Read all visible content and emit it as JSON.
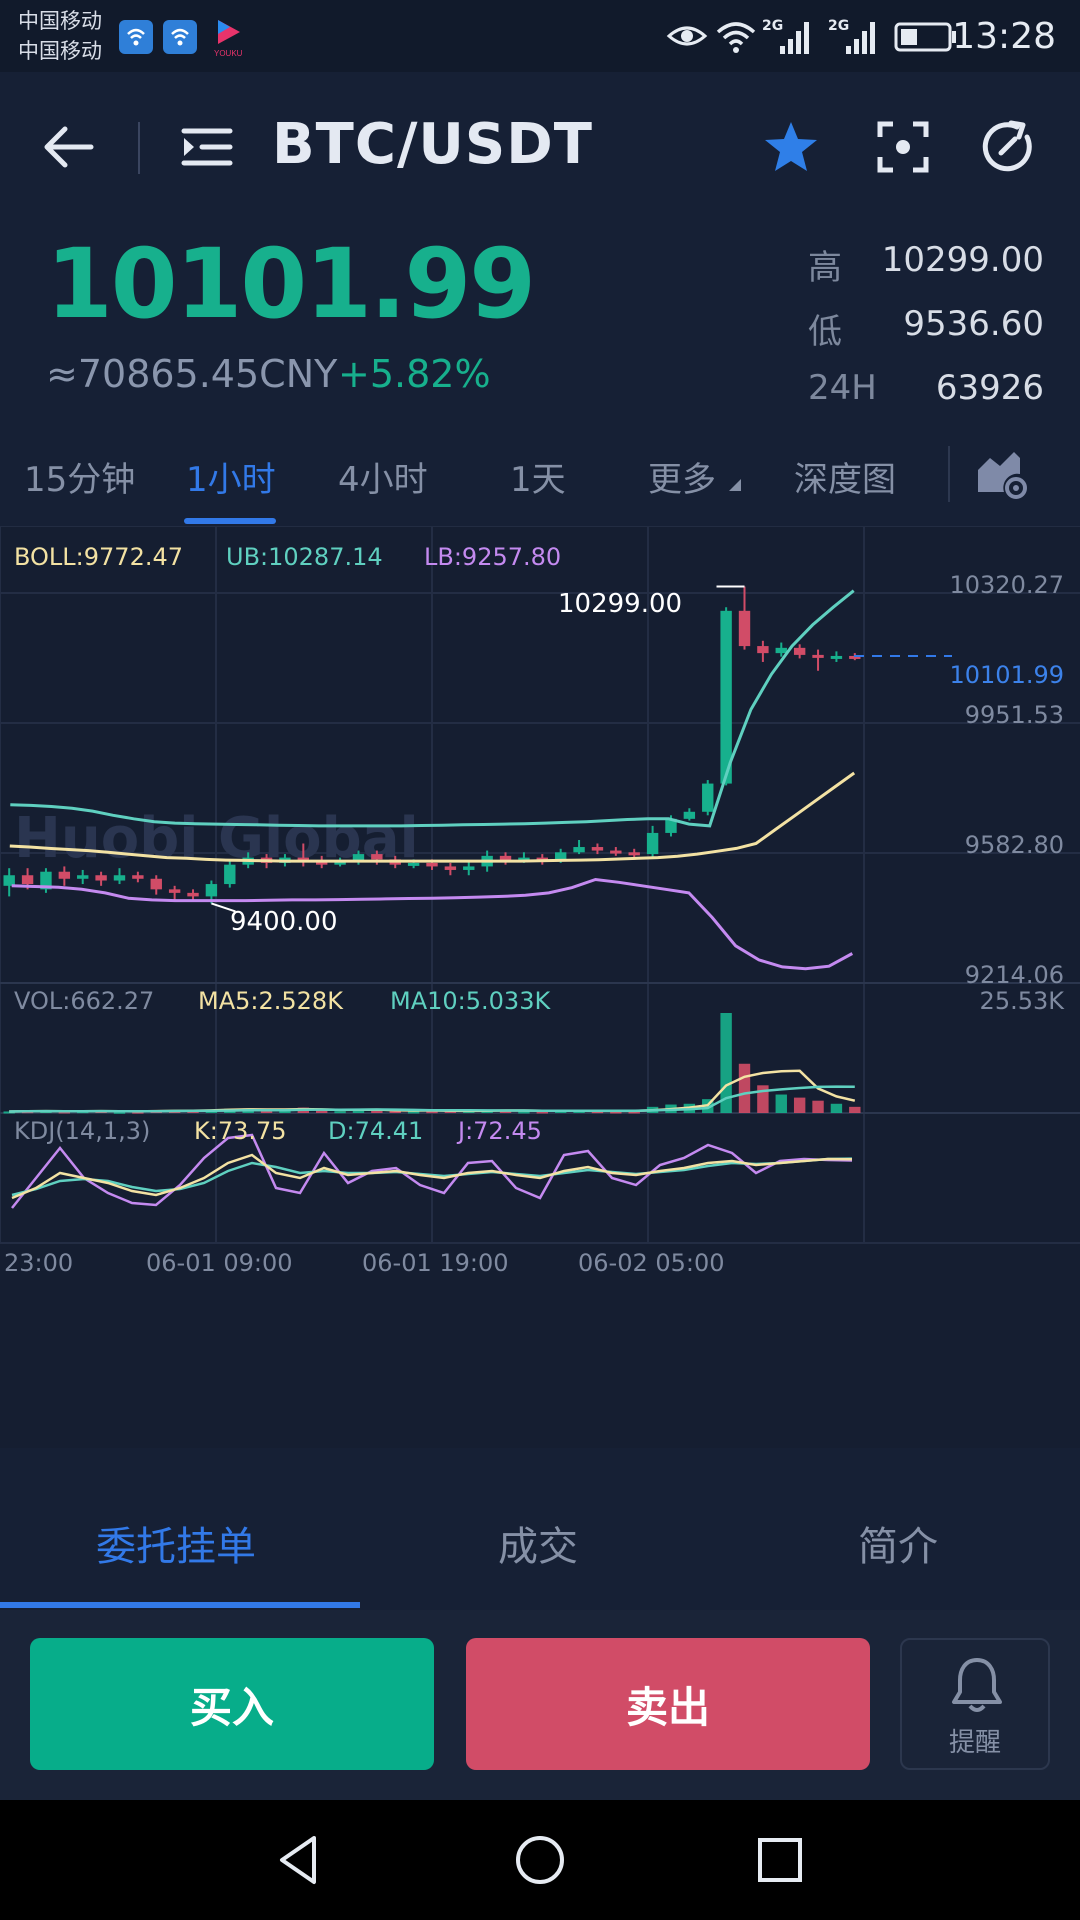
{
  "status_bar": {
    "carrier1": "中国移动",
    "carrier2": "中国移动",
    "time": "13:28",
    "sig1": "2G",
    "sig2": "2G",
    "icons": [
      "wifi-calling-icon",
      "wifi-calling-icon",
      "youku-icon",
      "eye-icon",
      "wifi-icon",
      "signal-icon",
      "signal-icon",
      "battery-icon"
    ]
  },
  "header": {
    "pair": "BTC/USDT",
    "icons": [
      "back-arrow-icon",
      "menu-list-icon",
      "star-icon",
      "scan-icon",
      "refresh-icon"
    ]
  },
  "ticker": {
    "price": "10101.99",
    "cny": "≈70865.45CNY",
    "change": "+5.82%",
    "high_label": "高",
    "high": "10299.00",
    "low_label": "低",
    "low": "9536.60",
    "vol_label": "24H",
    "vol": "63926"
  },
  "timeframes": {
    "items": [
      "15分钟",
      "1小时",
      "4小时",
      "1天",
      "更多",
      "深度图"
    ],
    "active": "1小时"
  },
  "colors": {
    "up": "#17b08d",
    "down": "#d14c67",
    "accent": "#3279e8",
    "boll": "#f3e2a3",
    "ub": "#5fd0c0",
    "lb": "#c48af0"
  },
  "indicators": {
    "boll": "BOLL:9772.47",
    "ub": "UB:10287.14",
    "lb": "LB:9257.80",
    "vol": "VOL:662.27",
    "ma5": "MA5:2.528K",
    "ma10": "MA10:5.033K",
    "kdj": "KDJ(14,1,3)",
    "k": "K:73.75",
    "d": "D:74.41",
    "j": "J:72.45"
  },
  "chart_data": {
    "type": "candlestick",
    "price_axis": [
      "10320.27",
      "9951.53",
      "9582.80",
      "9214.06"
    ],
    "last_price_label": "10101.99",
    "max_label": "10299.00",
    "min_label": "9400.00",
    "volume_axis_max": "25.53K",
    "x_ticks": [
      "23:00",
      "06-01 09:00",
      "06-01 19:00",
      "06-02 05:00"
    ],
    "watermark": "Huobi Global",
    "ylim": [
      9214.06,
      10320.27
    ],
    "candles": [
      [
        9450,
        9480,
        9420,
        9500,
        0.1
      ],
      [
        9480,
        9455,
        9440,
        9500,
        0.12
      ],
      [
        9440,
        9490,
        9430,
        9500,
        0.15
      ],
      [
        9490,
        9470,
        9450,
        9505,
        0.1
      ],
      [
        9470,
        9480,
        9455,
        9495,
        0.12
      ],
      [
        9480,
        9465,
        9450,
        9490,
        0.14
      ],
      [
        9465,
        9480,
        9455,
        9500,
        0.08
      ],
      [
        9480,
        9470,
        9460,
        9490,
        0.09
      ],
      [
        9470,
        9440,
        9425,
        9480,
        0.18
      ],
      [
        9440,
        9430,
        9410,
        9450,
        0.2
      ],
      [
        9430,
        9420,
        9405,
        9440,
        0.16
      ],
      [
        9420,
        9455,
        9400,
        9465,
        0.22
      ],
      [
        9455,
        9510,
        9445,
        9520,
        0.28
      ],
      [
        9510,
        9530,
        9500,
        9545,
        0.3
      ],
      [
        9530,
        9515,
        9500,
        9540,
        0.18
      ],
      [
        9515,
        9530,
        9505,
        9540,
        0.15
      ],
      [
        9530,
        9520,
        9505,
        9570,
        0.35
      ],
      [
        9520,
        9510,
        9500,
        9535,
        0.2
      ],
      [
        9510,
        9520,
        9505,
        9530,
        0.12
      ],
      [
        9520,
        9540,
        9510,
        9550,
        0.25
      ],
      [
        9540,
        9525,
        9510,
        9550,
        0.2
      ],
      [
        9525,
        9510,
        9500,
        9535,
        0.15
      ],
      [
        9510,
        9515,
        9500,
        9525,
        0.1
      ],
      [
        9515,
        9505,
        9495,
        9525,
        0.12
      ],
      [
        9505,
        9495,
        9480,
        9515,
        0.14
      ],
      [
        9495,
        9505,
        9480,
        9520,
        0.16
      ],
      [
        9505,
        9535,
        9490,
        9550,
        0.22
      ],
      [
        9535,
        9520,
        9510,
        9545,
        0.18
      ],
      [
        9520,
        9530,
        9515,
        9545,
        0.1
      ],
      [
        9530,
        9525,
        9510,
        9540,
        0.1
      ],
      [
        9525,
        9545,
        9515,
        9555,
        0.15
      ],
      [
        9545,
        9560,
        9540,
        9580,
        0.2
      ],
      [
        9560,
        9550,
        9540,
        9570,
        0.12
      ],
      [
        9550,
        9545,
        9535,
        9560,
        0.1
      ],
      [
        9545,
        9540,
        9530,
        9555,
        0.1
      ],
      [
        9540,
        9600,
        9530,
        9620,
        0.4
      ],
      [
        9600,
        9640,
        9590,
        9650,
        0.55
      ],
      [
        9640,
        9660,
        9635,
        9670,
        0.6
      ],
      [
        9660,
        9740,
        9650,
        9750,
        0.9
      ],
      [
        9740,
        10230,
        9735,
        10240,
        6.5
      ],
      [
        10230,
        10130,
        10120,
        10299,
        3.2
      ],
      [
        10130,
        10110,
        10085,
        10145,
        1.8
      ],
      [
        10110,
        10125,
        10100,
        10140,
        1.2
      ],
      [
        10125,
        10105,
        10095,
        10135,
        1.0
      ],
      [
        10105,
        10100,
        10060,
        10120,
        0.8
      ],
      [
        10100,
        10102,
        10085,
        10115,
        0.6
      ],
      [
        10102,
        10101.99,
        10090,
        10110,
        0.4
      ]
    ],
    "boll": [
      9563,
      9560,
      9556,
      9553,
      9550,
      9545,
      9540,
      9535,
      9530,
      9528,
      9525,
      9523,
      9522,
      9521,
      9520,
      9520,
      9520,
      9520,
      9520,
      9520,
      9520,
      9520,
      9520,
      9520,
      9520,
      9520,
      9520,
      9521,
      9522,
      9523,
      9524,
      9526,
      9528,
      9530,
      9534,
      9540,
      9548,
      9556,
      9570,
      9610,
      9650,
      9690,
      9730,
      9770
    ],
    "ub": [
      9680,
      9678,
      9675,
      9670,
      9662,
      9650,
      9640,
      9632,
      9628,
      9626,
      9625,
      9624,
      9623,
      9622,
      9621,
      9620,
      9620,
      9620,
      9620,
      9620,
      9621,
      9622,
      9623,
      9624,
      9625,
      9626,
      9628,
      9630,
      9632,
      9635,
      9638,
      9640,
      9640,
      9625,
      9620,
      9800,
      9950,
      10050,
      10130,
      10190,
      10240,
      10287
    ],
    "lb": [
      9450,
      9448,
      9446,
      9440,
      9430,
      9415,
      9410,
      9408,
      9408,
      9408,
      9408,
      9409,
      9410,
      9410,
      9411,
      9412,
      9413,
      9414,
      9415,
      9416,
      9418,
      9420,
      9423,
      9430,
      9445,
      9468,
      9460,
      9450,
      9440,
      9430,
      9360,
      9280,
      9240,
      9220,
      9215,
      9222,
      9258
    ],
    "kdj_k": [
      35,
      45,
      60,
      55,
      50,
      42,
      38,
      45,
      55,
      70,
      78,
      60,
      55,
      65,
      58,
      60,
      62,
      58,
      55,
      60,
      62,
      58,
      55,
      62,
      66,
      60,
      58,
      62,
      65,
      70,
      72,
      68,
      70,
      72,
      74,
      73.75
    ],
    "kdj_d": [
      38,
      44,
      52,
      54,
      52,
      46,
      42,
      44,
      50,
      62,
      70,
      66,
      60,
      62,
      60,
      60,
      61,
      59,
      57,
      59,
      61,
      59,
      57,
      60,
      63,
      61,
      59,
      61,
      63,
      67,
      70,
      69,
      70,
      72,
      74,
      74.41
    ],
    "kdj_j": [
      25,
      55,
      85,
      55,
      40,
      30,
      28,
      48,
      75,
      95,
      98,
      45,
      40,
      80,
      50,
      62,
      65,
      48,
      40,
      70,
      72,
      45,
      35,
      78,
      82,
      55,
      48,
      68,
      75,
      88,
      80,
      60,
      72,
      74,
      73,
      72.45
    ]
  },
  "bottom_tabs": {
    "items": [
      "委托挂单",
      "成交",
      "简介"
    ],
    "active": "委托挂单"
  },
  "actions": {
    "buy": "买入",
    "sell": "卖出",
    "alert": "提醒"
  }
}
